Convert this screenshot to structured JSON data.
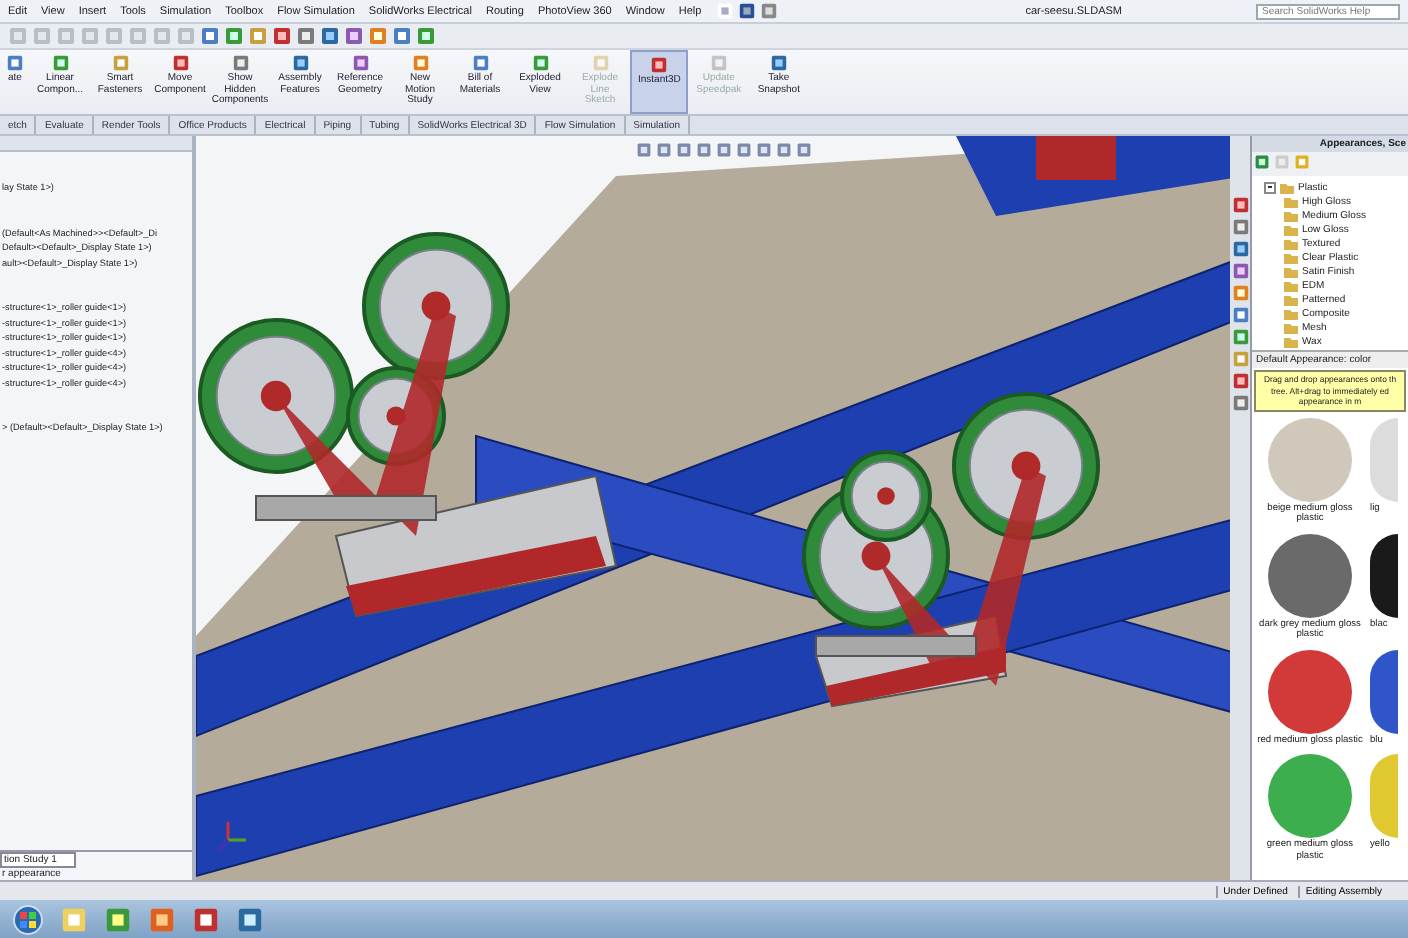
{
  "menu_bar": {
    "items": [
      "Edit",
      "View",
      "Insert",
      "Tools",
      "Simulation",
      "Toolbox",
      "Flow Simulation",
      "SolidWorks Electrical",
      "Routing",
      "PhotoView 360",
      "Window",
      "Help"
    ],
    "document_title": "car-seesu.SLDASM",
    "search": {
      "placeholder": "Search SolidWorks Help"
    }
  },
  "command_manager": {
    "buttons": [
      {
        "label": "ate",
        "selected": false,
        "disabled": false
      },
      {
        "label": "Linear Compon...",
        "selected": false,
        "disabled": false
      },
      {
        "label": "Smart Fasteners",
        "selected": false,
        "disabled": false
      },
      {
        "label": "Move Component",
        "selected": false,
        "disabled": false
      },
      {
        "label": "Show Hidden Components",
        "selected": false,
        "disabled": false
      },
      {
        "label": "Assembly Features",
        "selected": false,
        "disabled": false
      },
      {
        "label": "Reference Geometry",
        "selected": false,
        "disabled": false
      },
      {
        "label": "New Motion Study",
        "selected": false,
        "disabled": false
      },
      {
        "label": "Bill of Materials",
        "selected": false,
        "disabled": false
      },
      {
        "label": "Exploded View",
        "selected": false,
        "disabled": false
      },
      {
        "label": "Explode Line Sketch",
        "selected": false,
        "disabled": true
      },
      {
        "label": "Instant3D",
        "selected": true,
        "disabled": false
      },
      {
        "label": "Update Speedpak",
        "selected": false,
        "disabled": true
      },
      {
        "label": "Take Snapshot",
        "selected": false,
        "disabled": false
      }
    ],
    "tabs": [
      {
        "label": "etch",
        "selected": false
      },
      {
        "label": "Evaluate",
        "selected": false
      },
      {
        "label": "Render Tools",
        "selected": false
      },
      {
        "label": "Office Products",
        "selected": false
      },
      {
        "label": "Electrical",
        "selected": false
      },
      {
        "label": "Piping",
        "selected": false
      },
      {
        "label": "Tubing",
        "selected": false
      },
      {
        "label": "SolidWorks Electrical 3D",
        "selected": false
      },
      {
        "label": "Flow Simulation",
        "selected": false
      },
      {
        "label": "Simulation",
        "selected": false
      }
    ]
  },
  "feature_tree": {
    "groups": [
      [
        "lay State 1>)"
      ],
      [
        "(Default<As Machined>><Default>_Di",
        "Default><Default>_Display State 1>)",
        "ault><Default>_Display State 1>)"
      ],
      [
        "-structure<1>_roller guide<1>)",
        "-structure<1>_roller guide<1>)",
        "-structure<1>_roller guide<1>)",
        "-structure<1>_roller guide<4>)",
        "-structure<1>_roller guide<4>)",
        "-structure<1>_roller guide<4>)"
      ],
      [
        "> (Default><Default>_Display State 1>)"
      ]
    ],
    "bottom_tab": "tion Study 1",
    "hint": "r appearance"
  },
  "task_pane": {
    "title": "Appearances, Sce",
    "tree": {
      "label": "Plastic",
      "expanded": true,
      "children": [
        {
          "label": "High Gloss"
        },
        {
          "label": "Medium Gloss"
        },
        {
          "label": "Low Gloss"
        },
        {
          "label": "Textured"
        },
        {
          "label": "Clear Plastic"
        },
        {
          "label": "Satin Finish"
        },
        {
          "label": "EDM"
        },
        {
          "label": "Patterned"
        },
        {
          "label": "Composite"
        },
        {
          "label": "Mesh"
        },
        {
          "label": "Wax"
        }
      ]
    },
    "selection_label": "Default Appearance: color",
    "tooltip_lines": [
      "Drag and drop appearances onto th",
      "tree. Alt+drag to immediately ed",
      "appearance in m"
    ],
    "swatches": [
      {
        "label": "beige medium gloss plastic",
        "color": "#cfc8bb"
      },
      {
        "label": "lig",
        "color": "#dcdcdc"
      },
      {
        "label": "dark grey medium gloss plastic",
        "color": "#6a6a6a"
      },
      {
        "label": "blac",
        "color": "#1a1a1a"
      },
      {
        "label": "red medium gloss plastic",
        "color": "#d23a3a"
      },
      {
        "label": "blu",
        "color": "#2f55c8"
      },
      {
        "label": "green medium gloss plastic",
        "color": "#3cae4e"
      },
      {
        "label": "yello",
        "color": "#e0c830"
      }
    ]
  },
  "status_bar": {
    "items": [
      "Under Defined",
      "Editing Assembly"
    ]
  }
}
